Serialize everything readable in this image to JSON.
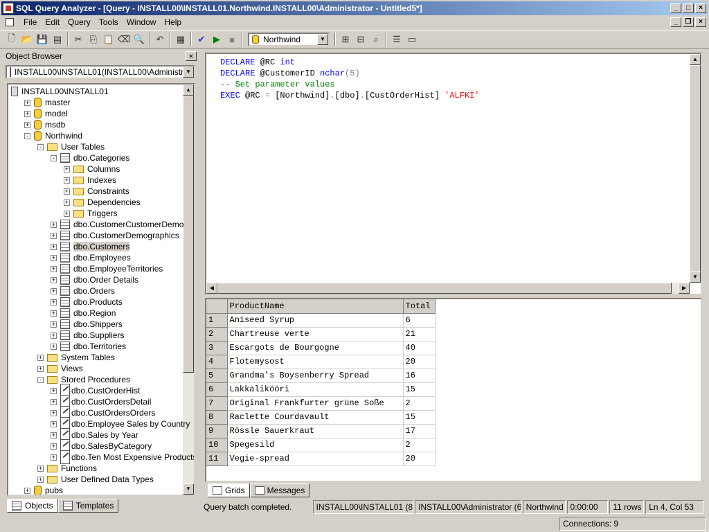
{
  "window": {
    "title": "SQL Query Analyzer - [Query - INSTALL00\\INSTALL01.Northwind.INSTALL00\\Administrator - Untitled5*]"
  },
  "menu": [
    "File",
    "Edit",
    "Query",
    "Tools",
    "Window",
    "Help"
  ],
  "toolbar": {
    "database": "Northwind"
  },
  "object_browser": {
    "title": "Object Browser",
    "server_combo": "INSTALL00\\INSTALL01(INSTALL00\\Administrator)",
    "tree": [
      {
        "label": "INSTALL00\\INSTALL01",
        "depth": 0,
        "icon": "server",
        "exp": ""
      },
      {
        "label": "master",
        "depth": 1,
        "icon": "db",
        "exp": "+"
      },
      {
        "label": "model",
        "depth": 1,
        "icon": "db",
        "exp": "+"
      },
      {
        "label": "msdb",
        "depth": 1,
        "icon": "db",
        "exp": "+"
      },
      {
        "label": "Northwind",
        "depth": 1,
        "icon": "db",
        "exp": "-"
      },
      {
        "label": "User Tables",
        "depth": 2,
        "icon": "fold",
        "exp": "-"
      },
      {
        "label": "dbo.Categories",
        "depth": 3,
        "icon": "tbl",
        "exp": "-"
      },
      {
        "label": "Columns",
        "depth": 4,
        "icon": "fold",
        "exp": "+"
      },
      {
        "label": "Indexes",
        "depth": 4,
        "icon": "fold",
        "exp": "+"
      },
      {
        "label": "Constraints",
        "depth": 4,
        "icon": "fold",
        "exp": "+"
      },
      {
        "label": "Dependencies",
        "depth": 4,
        "icon": "fold",
        "exp": "+"
      },
      {
        "label": "Triggers",
        "depth": 4,
        "icon": "fold",
        "exp": "+"
      },
      {
        "label": "dbo.CustomerCustomerDemo",
        "depth": 3,
        "icon": "tbl",
        "exp": "+"
      },
      {
        "label": "dbo.CustomerDemographics",
        "depth": 3,
        "icon": "tbl",
        "exp": "+"
      },
      {
        "label": "dbo.Customers",
        "depth": 3,
        "icon": "tbl",
        "exp": "+",
        "selected": true
      },
      {
        "label": "dbo.Employees",
        "depth": 3,
        "icon": "tbl",
        "exp": "+"
      },
      {
        "label": "dbo.EmployeeTerritories",
        "depth": 3,
        "icon": "tbl",
        "exp": "+"
      },
      {
        "label": "dbo.Order Details",
        "depth": 3,
        "icon": "tbl",
        "exp": "+"
      },
      {
        "label": "dbo.Orders",
        "depth": 3,
        "icon": "tbl",
        "exp": "+"
      },
      {
        "label": "dbo.Products",
        "depth": 3,
        "icon": "tbl",
        "exp": "+"
      },
      {
        "label": "dbo.Region",
        "depth": 3,
        "icon": "tbl",
        "exp": "+"
      },
      {
        "label": "dbo.Shippers",
        "depth": 3,
        "icon": "tbl",
        "exp": "+"
      },
      {
        "label": "dbo.Suppliers",
        "depth": 3,
        "icon": "tbl",
        "exp": "+"
      },
      {
        "label": "dbo.Territories",
        "depth": 3,
        "icon": "tbl",
        "exp": "+"
      },
      {
        "label": "System Tables",
        "depth": 2,
        "icon": "fold",
        "exp": "+"
      },
      {
        "label": "Views",
        "depth": 2,
        "icon": "fold",
        "exp": "+"
      },
      {
        "label": "Stored Procedures",
        "depth": 2,
        "icon": "fold",
        "exp": "-"
      },
      {
        "label": "dbo.CustOrderHist",
        "depth": 3,
        "icon": "sp",
        "exp": "+"
      },
      {
        "label": "dbo.CustOrdersDetail",
        "depth": 3,
        "icon": "sp",
        "exp": "+"
      },
      {
        "label": "dbo.CustOrdersOrders",
        "depth": 3,
        "icon": "sp",
        "exp": "+"
      },
      {
        "label": "dbo.Employee Sales by Country",
        "depth": 3,
        "icon": "sp",
        "exp": "+"
      },
      {
        "label": "dbo.Sales by Year",
        "depth": 3,
        "icon": "sp",
        "exp": "+"
      },
      {
        "label": "dbo.SalesByCategory",
        "depth": 3,
        "icon": "sp",
        "exp": "+"
      },
      {
        "label": "dbo.Ten Most Expensive Products",
        "depth": 3,
        "icon": "sp",
        "exp": "+"
      },
      {
        "label": "Functions",
        "depth": 2,
        "icon": "fold",
        "exp": "+"
      },
      {
        "label": "User Defined Data Types",
        "depth": 2,
        "icon": "fold",
        "exp": "+"
      },
      {
        "label": "pubs",
        "depth": 1,
        "icon": "db",
        "exp": "+"
      }
    ],
    "tabs": [
      "Objects",
      "Templates"
    ]
  },
  "editor": {
    "lines": [
      [
        {
          "t": "DECLARE ",
          "c": "kw"
        },
        {
          "t": "@RC ",
          "c": ""
        },
        {
          "t": "int",
          "c": "kw"
        }
      ],
      [
        {
          "t": "DECLARE ",
          "c": "kw"
        },
        {
          "t": "@CustomerID ",
          "c": ""
        },
        {
          "t": "nchar",
          "c": "kw"
        },
        {
          "t": "(5)",
          "c": "gr"
        }
      ],
      [
        {
          "t": "-- Set parameter values",
          "c": "cm"
        }
      ],
      [
        {
          "t": "EXEC ",
          "c": "kw"
        },
        {
          "t": "@RC ",
          "c": ""
        },
        {
          "t": "= ",
          "c": "gr"
        },
        {
          "t": "[Northwind]",
          "c": ""
        },
        {
          "t": ".",
          "c": "gr"
        },
        {
          "t": "[dbo]",
          "c": ""
        },
        {
          "t": ".",
          "c": "gr"
        },
        {
          "t": "[CustOrderHist] ",
          "c": ""
        },
        {
          "t": "'ALFKI'",
          "c": "str"
        }
      ]
    ]
  },
  "results": {
    "columns": [
      "ProductName",
      "Total"
    ],
    "rows": [
      [
        "1",
        "Aniseed Syrup",
        "6"
      ],
      [
        "2",
        "Chartreuse verte",
        "21"
      ],
      [
        "3",
        "Escargots de Bourgogne",
        "40"
      ],
      [
        "4",
        "Flotemysost",
        "20"
      ],
      [
        "5",
        "Grandma's Boysenberry Spread",
        "16"
      ],
      [
        "6",
        "Lakkalikööri",
        "15"
      ],
      [
        "7",
        "Original Frankfurter grüne Soße",
        "2"
      ],
      [
        "8",
        "Raclette Courdavault",
        "15"
      ],
      [
        "9",
        "Rössle Sauerkraut",
        "17"
      ],
      [
        "10",
        "Spegesild",
        "2"
      ],
      [
        "11",
        "Vegie-spread",
        "20"
      ]
    ],
    "tabs": [
      "Grids",
      "Messages"
    ]
  },
  "status": {
    "message": "Query batch completed.",
    "server": "INSTALL00\\INSTALL01 (8.0)",
    "user": "INSTALL00\\Administrator (61)",
    "database": "Northwind",
    "time": "0:00:00",
    "rows": "11 rows",
    "position": "Ln 4, Col 53",
    "connections": "Connections: 9"
  }
}
